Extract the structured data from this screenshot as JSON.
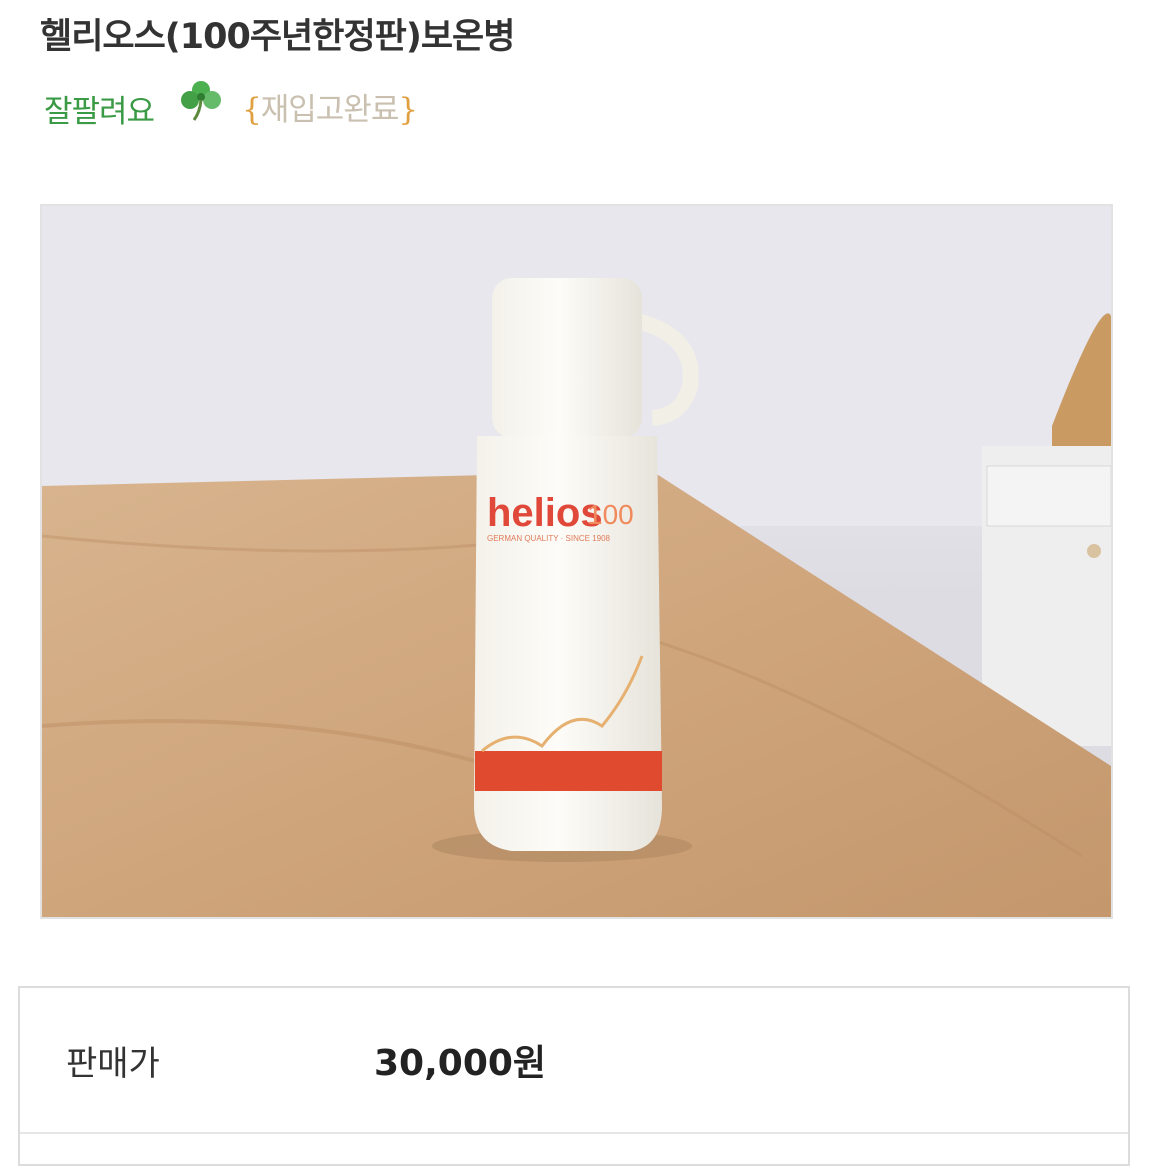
{
  "product": {
    "title": "헬리오스(100주년한정판)보온병",
    "badge_a": "잘팔려요",
    "badge_b_open": "{",
    "badge_b": "재입고완료",
    "badge_b_close": "}"
  },
  "photo": {
    "brand": "helios",
    "edition": "100",
    "tagline": "GERMAN QUALITY · SINCE 1908"
  },
  "pricing": {
    "label": "판매가",
    "value": "30,000원"
  },
  "colors": {
    "badge_green": "#3a9a45",
    "badge_orange": "#e0a040",
    "brand_red": "#e0483a"
  }
}
